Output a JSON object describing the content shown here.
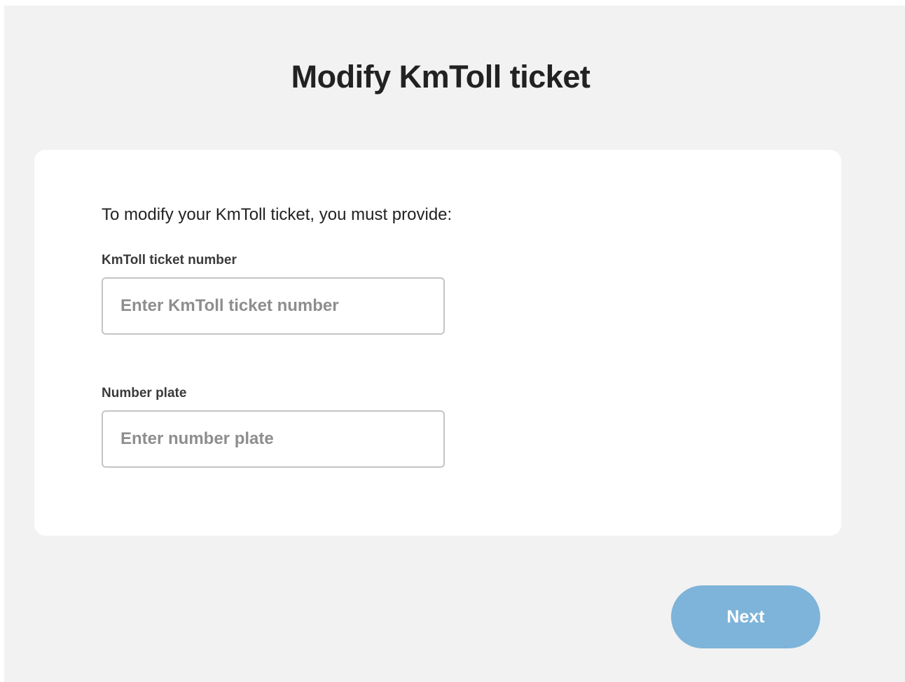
{
  "page": {
    "title": "Modify KmToll ticket"
  },
  "form": {
    "intro": "To modify your KmToll ticket, you must provide:",
    "ticket_number": {
      "label": "KmToll ticket number",
      "placeholder": "Enter KmToll ticket number",
      "value": ""
    },
    "number_plate": {
      "label": "Number plate",
      "placeholder": "Enter number plate",
      "value": ""
    }
  },
  "actions": {
    "next_label": "Next"
  },
  "colors": {
    "background": "#f2f2f2",
    "card": "#ffffff",
    "button_disabled": "#7eb4d9",
    "title_text": "#222222",
    "input_border": "#c4c4c4"
  }
}
